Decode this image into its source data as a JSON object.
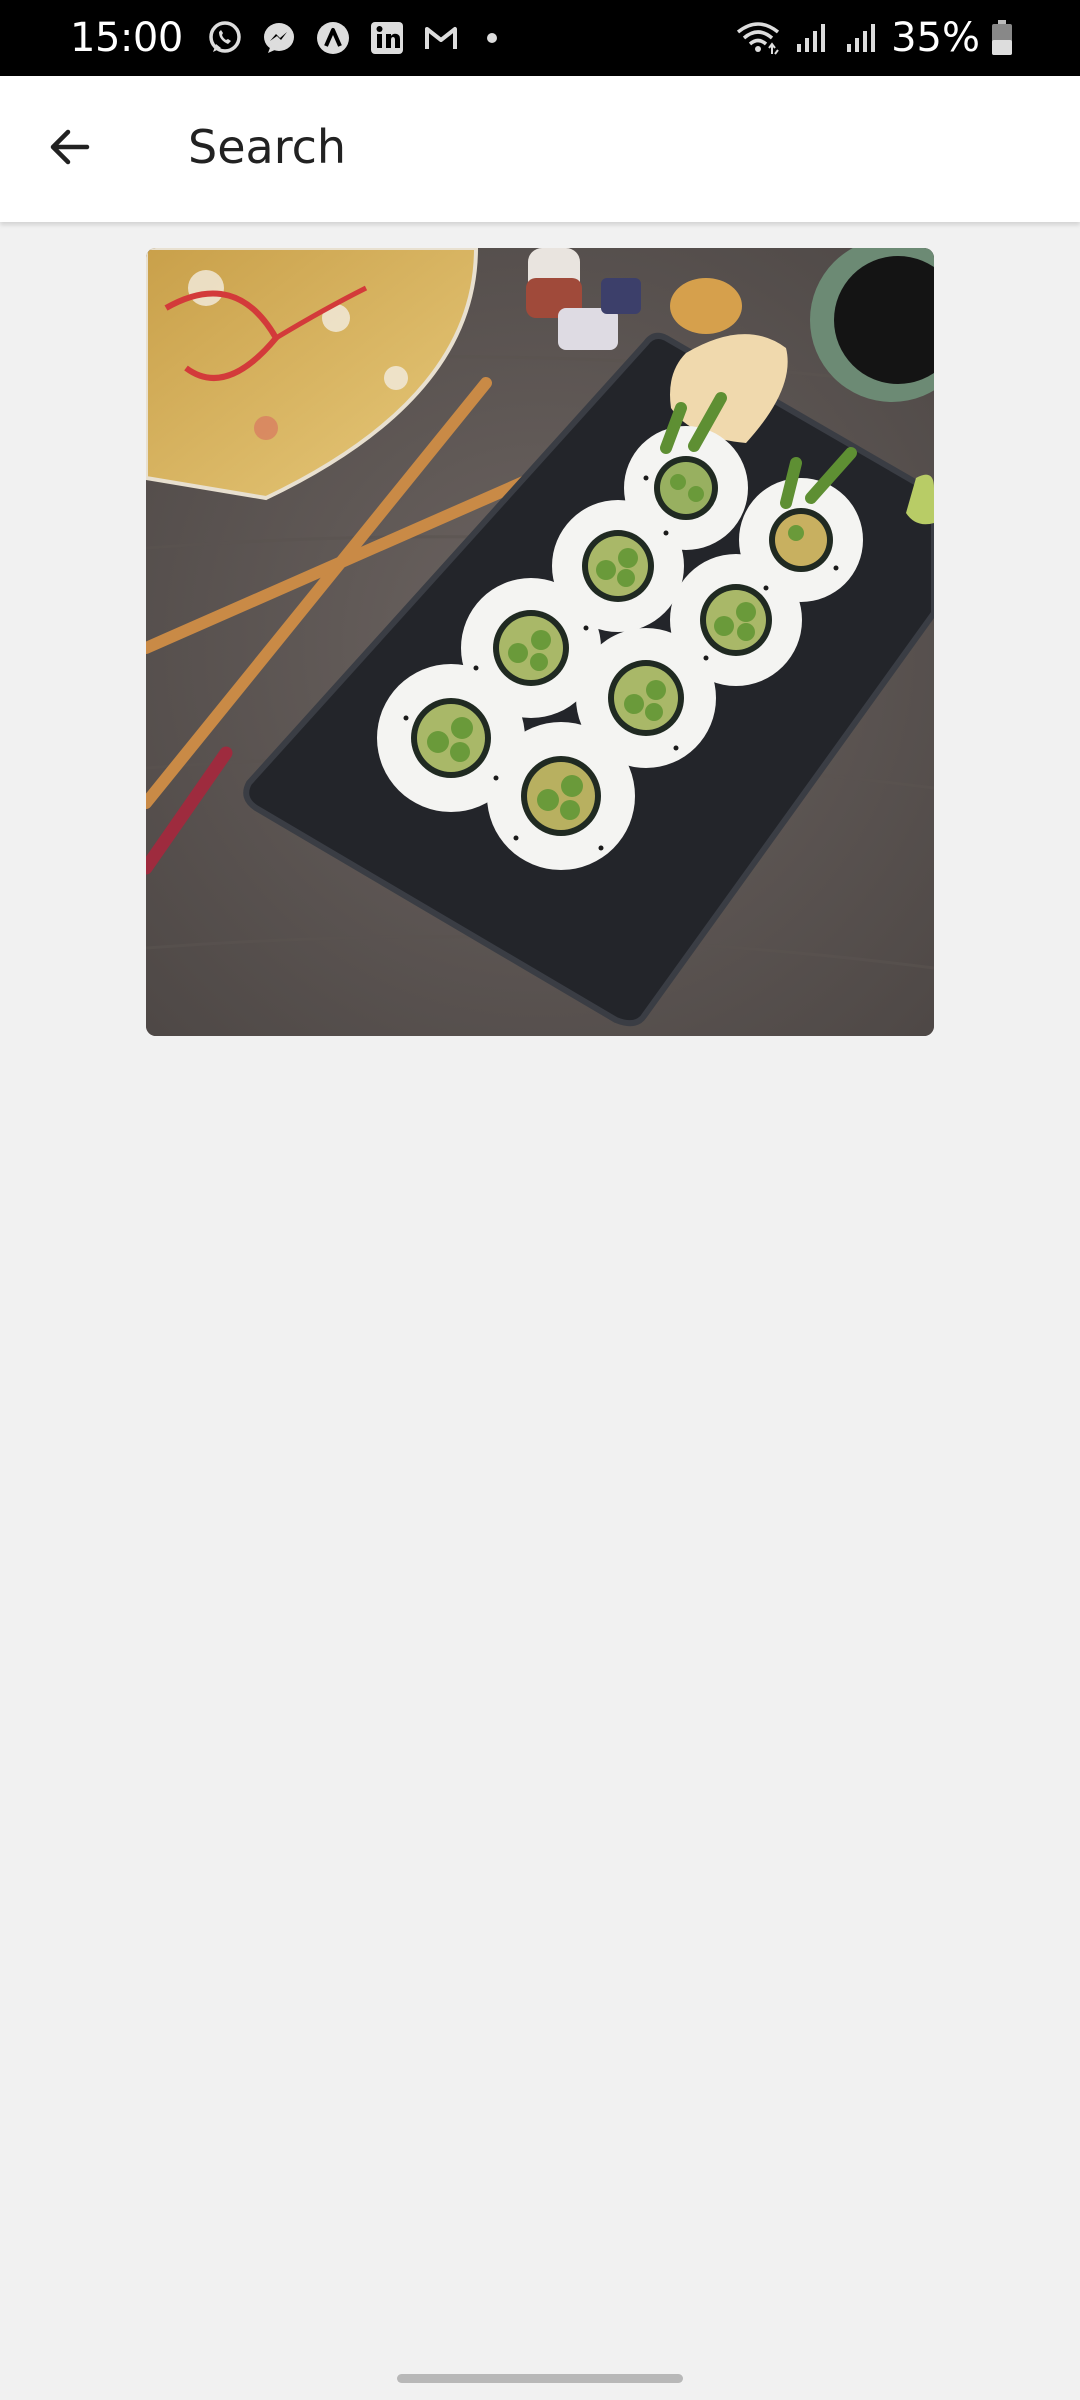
{
  "status_bar": {
    "time": "15:00",
    "battery_text": "35%",
    "notification_icons": [
      "whatsapp-icon",
      "messenger-icon",
      "arc-icon",
      "linkedin-icon",
      "gmail-icon"
    ],
    "system_icons": [
      "wifi-icon",
      "signal-icon",
      "signal-icon",
      "battery-icon"
    ]
  },
  "app_bar": {
    "back_icon": "arrow-left-icon",
    "title": "Search"
  },
  "content": {
    "image_subject": "sushi-rolls-photo"
  }
}
